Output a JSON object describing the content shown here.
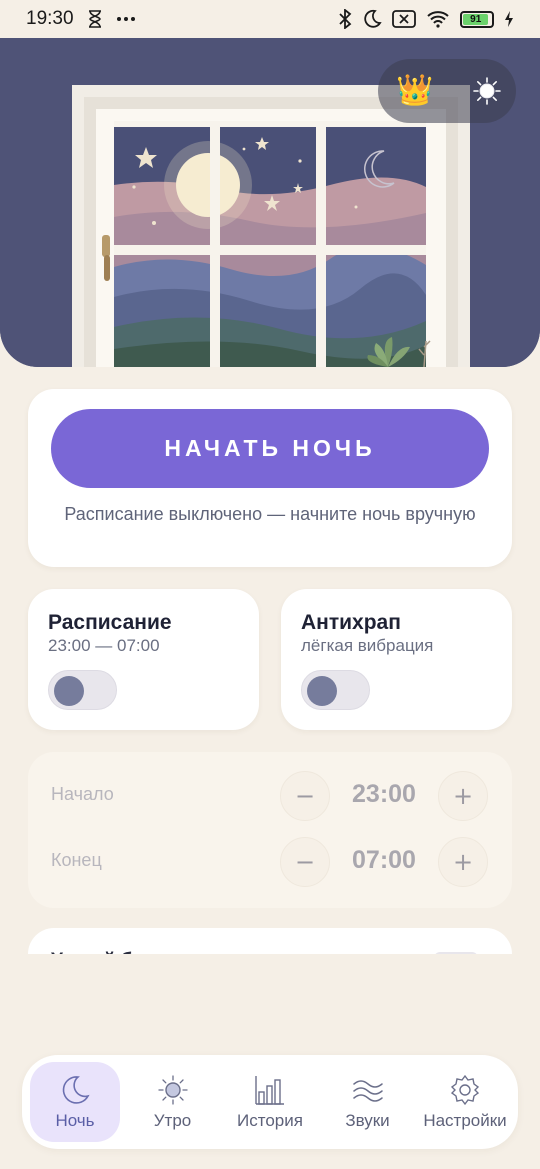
{
  "status_bar": {
    "time": "19:30",
    "battery_level": "91",
    "icons": [
      "hourglass-icon",
      "more-dots-icon",
      "bluetooth-icon",
      "moon-icon",
      "sim-off-icon",
      "wifi-icon",
      "battery-icon",
      "charging-icon"
    ]
  },
  "hero": {
    "premium_icon": "crown-icon",
    "theme_icon": "sun-icon"
  },
  "start": {
    "button_label": "НАЧАТЬ НОЧЬ",
    "hint": "Расписание выключено — начните ночь вручную"
  },
  "schedule_card": {
    "title": "Расписание",
    "subtitle": "23:00 — 07:00",
    "enabled": false
  },
  "antisnore_card": {
    "title": "Антихрап",
    "subtitle": "лёгкая вибрация",
    "enabled": false
  },
  "time_settings": {
    "start_label": "Начало",
    "start_value": "23:00",
    "end_label": "Конец",
    "end_value": "07:00",
    "minus": "−",
    "plus": "+"
  },
  "peek_card": {
    "title": "Умный будильник"
  },
  "nav": {
    "items": [
      {
        "label": "Ночь",
        "icon": "moon-icon",
        "active": true
      },
      {
        "label": "Утро",
        "icon": "sun-icon",
        "active": false
      },
      {
        "label": "История",
        "icon": "bar-chart-icon",
        "active": false
      },
      {
        "label": "Звуки",
        "icon": "waves-icon",
        "active": false
      },
      {
        "label": "Настройки",
        "icon": "gear-icon",
        "active": false
      }
    ]
  },
  "colors": {
    "background": "#f5efe6",
    "accent": "#7a67d6",
    "active_nav_bg": "#e9e3fb",
    "toggle_knob": "#767c9c"
  }
}
